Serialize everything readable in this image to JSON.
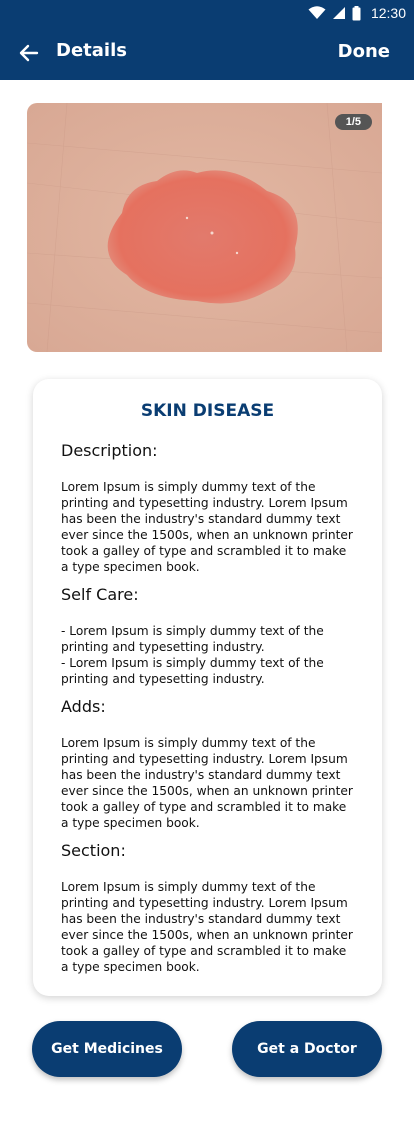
{
  "status_bar": {
    "time": "12:30"
  },
  "header": {
    "title": "Details",
    "done_label": "Done"
  },
  "gallery": {
    "counter": "1/5"
  },
  "card": {
    "title": "SKIN DISEASE",
    "description": {
      "heading": "Description:",
      "lines": [
        "Lorem Ipsum is simply dummy text of the",
        "printing and typesetting industry. Lorem Ipsum",
        "has been the industry's standard dummy text",
        "ever since the 1500s, when an unknown printer",
        "took a galley of type and scrambled it to make",
        "a type specimen book."
      ]
    },
    "self_care": {
      "heading": "Self Care:",
      "lines": [
        "- Lorem Ipsum is simply dummy text of the",
        "printing and typesetting industry.",
        "- Lorem Ipsum is simply dummy text of the",
        "printing and typesetting industry."
      ]
    },
    "adds": {
      "heading": "Adds:",
      "lines": [
        "Lorem Ipsum is simply dummy text of the",
        "printing and typesetting industry. Lorem Ipsum",
        "has been the industry's standard dummy text",
        "ever since the 1500s, when an unknown printer",
        "took a galley of type and scrambled it to make",
        "a type specimen book."
      ]
    },
    "section": {
      "heading": "Section:",
      "lines": [
        "Lorem Ipsum is simply dummy text of the",
        "printing and typesetting industry. Lorem Ipsum",
        "has been the industry's standard dummy text",
        "ever since the 1500s, when an unknown printer",
        "took a galley of type and scrambled it to make",
        "a type specimen book."
      ]
    }
  },
  "actions": {
    "medicines_label": "Get Medicines",
    "doctor_label": "Get a Doctor"
  },
  "colors": {
    "primary": "#0a3d72",
    "background": "#ffffff"
  }
}
